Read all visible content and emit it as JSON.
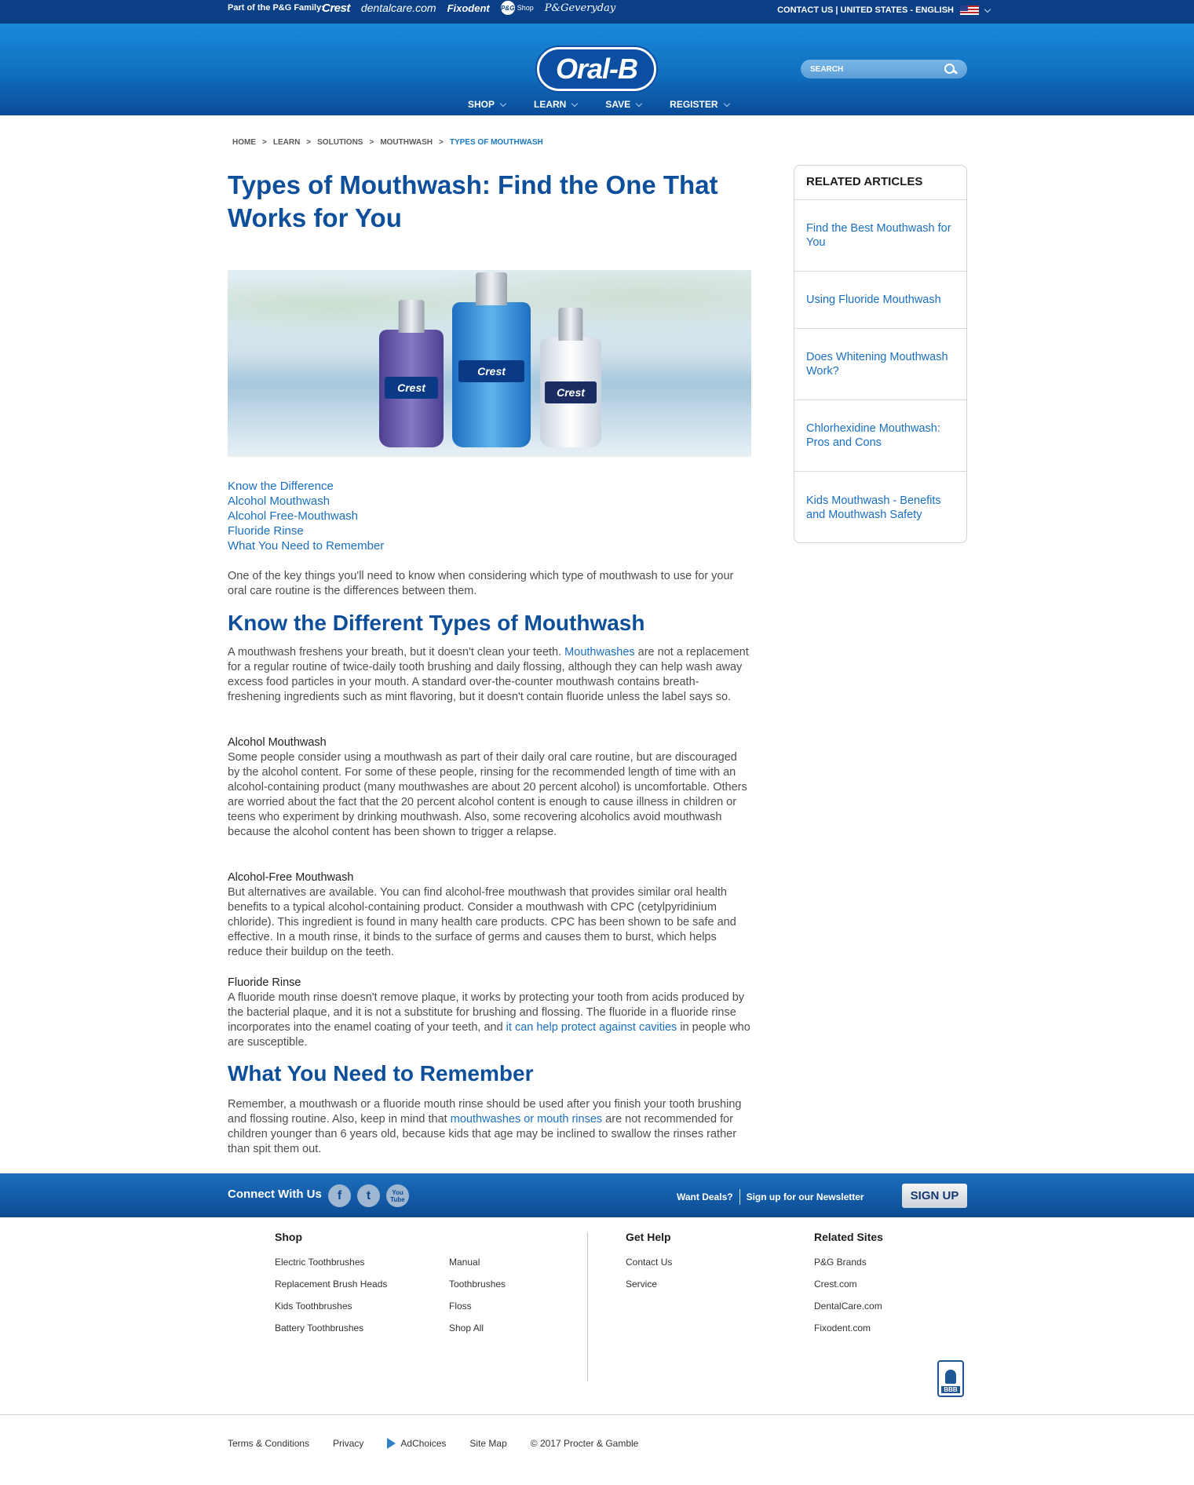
{
  "topbar": {
    "family_label": "Part of the P&G Family:",
    "brands": [
      "Crest",
      "dentalcare.com",
      "Fixodent",
      "P&G",
      "Shop",
      "P&Geveryday"
    ],
    "utility": "CONTACT US | UNITED STATES - ENGLISH"
  },
  "header": {
    "logo": "Oral-B",
    "search_placeholder": "SEARCH",
    "nav": [
      "SHOP",
      "LEARN",
      "SAVE",
      "REGISTER"
    ]
  },
  "breadcrumb": [
    "HOME",
    ">",
    "LEARN",
    ">",
    "SOLUTIONS",
    ">",
    "MOUTHWASH",
    ">",
    "TYPES OF MOUTHWASH"
  ],
  "article": {
    "title": "Types of Mouthwash: Find the One That Works for You",
    "hero_bottles": [
      "Crest",
      "Crest",
      "Crest"
    ],
    "toc": [
      "Know the Difference",
      "Alcohol Mouthwash",
      "Alcohol Free-Mouthwash",
      "Fluoride Rinse",
      "What You Need to Remember"
    ],
    "intro": "One of the key things you'll need to know when considering which type of mouthwash to use for your oral care routine is the differences between them.",
    "h2_types": "Know the Different Types of Mouthwash",
    "p1_a": "A mouthwash freshens your breath, but it doesn't clean your teeth. ",
    "p1_link": "Mouthwashes",
    "p1_b": " are not a replacement for a regular routine of twice-daily tooth brushing and daily flossing, although they can help wash away excess food particles in your mouth. A standard over-the-counter mouthwash contains breath-freshening ingredients such as mint flavoring, but it doesn't contain fluoride unless the label says so.",
    "alcohol_title": "Alcohol Mouthwash",
    "alcohol_body": "Some people consider using a mouthwash as part of their daily oral care routine, but are discouraged by the alcohol content. For some of these people, rinsing for the recommended length of time with an alcohol-containing product (many mouthwashes are about 20 percent alcohol) is uncomfortable. Others are worried about the fact that the 20 percent alcohol content is enough to cause illness in children or teens who experiment by drinking mouthwash. Also, some recovering alcoholics avoid mouthwash because the alcohol content has been shown to trigger a relapse.",
    "free_title": "Alcohol-Free Mouthwash",
    "free_body": "But alternatives are available. You can find alcohol-free mouthwash that provides similar oral health benefits to a typical alcohol-containing product. Consider a mouthwash with CPC (cetylpyridinium chloride). This ingredient is found in many health care products. CPC has been shown to be safe and effective. In a mouth rinse, it binds to the surface of germs and causes them to burst, which helps reduce their buildup on the teeth.",
    "fluoride_title": "Fluoride Rinse",
    "fluoride_body_a": "A fluoride mouth rinse doesn't remove plaque, it works by protecting your tooth from acids produced by the bacterial plaque, and it is not a substitute for brushing and flossing. The fluoride in a fluoride rinse incorporates into the enamel coating of your teeth, and ",
    "fluoride_link": "it can help protect against cavities",
    "fluoride_body_b": " in people who are susceptible.",
    "h2_remember": "What You Need to Remember",
    "p4_a": "Remember, a mouthwash or a fluoride mouth rinse should be used after you finish your tooth brushing and flossing routine. Also, keep in mind that ",
    "p4_link": "mouthwashes or mouth rinses",
    "p4_b": " are not recommended for children younger than 6 years old, because kids that age may be inclined to swallow the rinses rather than spit them out."
  },
  "sidebar": {
    "title": "RELATED ARTICLES",
    "items": [
      "Find the Best Mouthwash for You",
      "Using Fluoride Mouthwash",
      "Does Whitening Mouthwash Work?",
      "Chlorhexidine Mouthwash: Pros and Cons",
      "Kids Mouthwash - Benefits and Mouthwash Safety"
    ]
  },
  "connect": {
    "label": "Connect With Us",
    "social": [
      "f",
      "t",
      "You Tube"
    ],
    "deals": "Want Deals?",
    "newsletter": "Sign up for our Newsletter",
    "signup": "SIGN UP"
  },
  "footer": {
    "shop_title": "Shop",
    "shop_col1": [
      "Electric Toothbrushes",
      "Replacement Brush Heads",
      "Kids Toothbrushes",
      "Battery Toothbrushes"
    ],
    "shop_col2": [
      "Manual",
      "Toothbrushes",
      "Floss",
      "Shop All"
    ],
    "help_title": "Get Help",
    "help": [
      "Contact Us",
      "Service"
    ],
    "related_title": "Related Sites",
    "related": [
      "P&G Brands",
      "Crest.com",
      "DentalCare.com",
      "Fixodent.com"
    ],
    "bbb": "BBB",
    "legal": [
      "Terms & Conditions",
      "Privacy",
      "AdChoices",
      "Site Map",
      "© 2017 Procter & Gamble"
    ]
  },
  "colors": {
    "brand_blue": "#0d4f9a",
    "link_blue": "#1a6fc0",
    "topbar": "#0a3f86"
  }
}
